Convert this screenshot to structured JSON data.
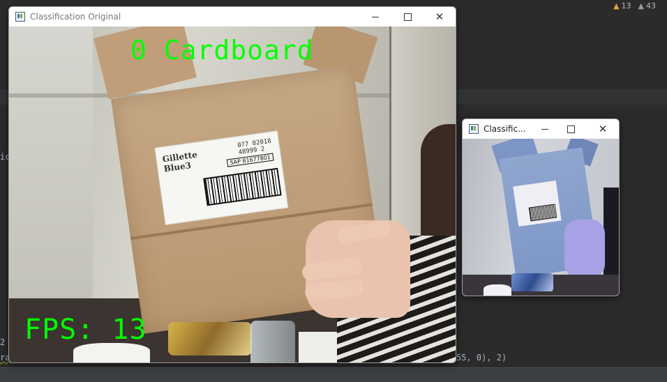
{
  "ide": {
    "warnings_count": "13",
    "weak_warnings_count": "43",
    "code_fragment_left_top": "ic",
    "code_fragment_left_mid": "2",
    "code_fragment_left_bottom": "ra",
    "code_fragment_right": "55, 0), 2)"
  },
  "windows": [
    {
      "id": "original",
      "title": "Classification Original",
      "overlay_label": "0 Cardboard",
      "overlay_fps": "FPS: 13"
    },
    {
      "id": "secondary",
      "title": "Classific..."
    }
  ],
  "controls": {
    "minimize": "—",
    "maximize": "☐",
    "close": "✕"
  },
  "colors": {
    "overlay_text": "#00ff00",
    "ide_background": "#2b2b2b",
    "warning_icon": "#e2a33c"
  },
  "icons": [
    "warning-icon",
    "weak-warning-icon",
    "app-icon",
    "minimize-icon",
    "maximize-icon",
    "close-icon"
  ]
}
